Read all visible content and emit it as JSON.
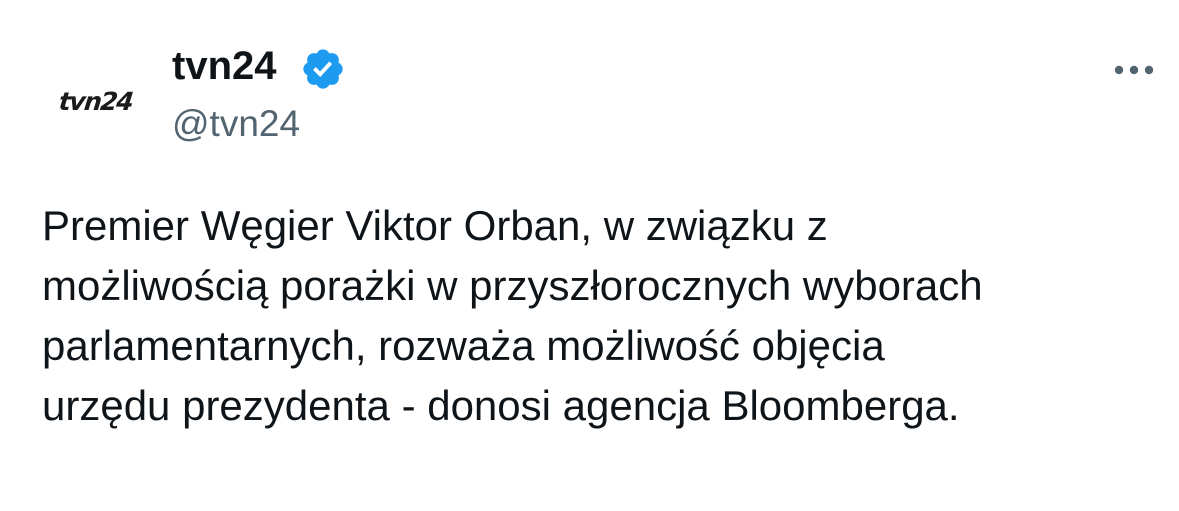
{
  "author": {
    "avatar_logo_text": "tvn24",
    "display_name": "tvn24",
    "handle": "@tvn24",
    "verified_icon": "verified-badge-icon",
    "verified_color": "#1d9bf0"
  },
  "more_icon": "more-horizontal-icon",
  "tweet": {
    "lines": [
      "Premier Węgier Viktor Orban, w związku z",
      "możliwością porażki w przyszłorocznych wyborach",
      "parlamentarnych, rozważa możliwość objęcia",
      "urzędu prezydenta - donosi agencja Bloomberga."
    ]
  }
}
